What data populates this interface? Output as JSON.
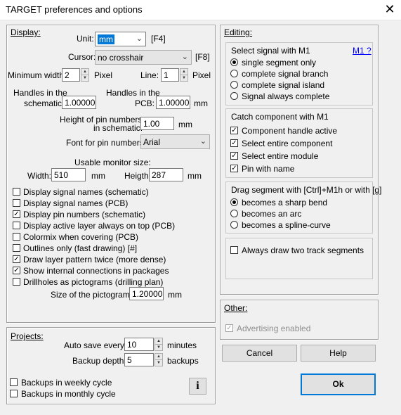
{
  "window": {
    "title": "TARGET preferences and options",
    "close": "✕"
  },
  "display": {
    "heading": "Display:",
    "unit_label": "Unit:",
    "unit_value": "mm",
    "unit_key": "[F4]",
    "cursor_label": "Cursor:",
    "cursor_value": "no crosshair",
    "cursor_key": "[F8]",
    "minwidth_label": "Minimum width:",
    "minwidth_value": "2",
    "minwidth_unit": "Pixel",
    "line_label": "Line:",
    "line_value": "1",
    "line_unit": "Pixel",
    "handles_sch_label1": "Handles in the",
    "handles_sch_label2": "schematic:",
    "handles_sch_value": "1.00000",
    "handles_pcb_label1": "Handles in the",
    "handles_pcb_label2": "PCB:",
    "handles_pcb_value": "1.00000",
    "handles_pcb_unit": "mm",
    "pinheight_label1": "Height of pin numbers",
    "pinheight_label2": "in schematic:",
    "pinheight_value": "1.00",
    "pinheight_unit": "mm",
    "font_label": "Font for pin numbers:",
    "font_value": "Arial",
    "monitor_label": "Usable monitor size:",
    "width_label": "Width:",
    "width_value": "510",
    "width_unit": "mm",
    "height_label": "Heigth:",
    "height_value": "287",
    "height_unit": "mm",
    "checks": [
      {
        "label": "Display signal names (schematic)",
        "checked": false
      },
      {
        "label": "Display signal names (PCB)",
        "checked": false
      },
      {
        "label": "Display pin numbers (schematic)",
        "checked": true
      },
      {
        "label": "Display active layer always on top (PCB)",
        "checked": false
      },
      {
        "label": "Colormix when covering (PCB)",
        "checked": false
      },
      {
        "label": "Outlines only (fast drawing)  [#]",
        "checked": false
      },
      {
        "label": "Draw layer pattern twice (more dense)",
        "checked": true
      },
      {
        "label": "Show internal connections in packages",
        "checked": true
      },
      {
        "label": "Drillholes as pictograms (drilling plan)",
        "checked": false
      }
    ],
    "picto_label": "Size of the pictograms:",
    "picto_value": "1.20000",
    "picto_unit": "mm"
  },
  "projects": {
    "heading": "Projects:",
    "autosave_label": "Auto save every:",
    "autosave_value": "10",
    "autosave_unit": "minutes",
    "depth_label": "Backup depth:",
    "depth_value": "5",
    "depth_unit": "backups",
    "weekly": "Backups in weekly cycle",
    "monthly": "Backups in monthly cycle",
    "info": "i"
  },
  "editing": {
    "heading": "Editing:",
    "m1_title": "Select signal with M1",
    "m1_help": "M1 ?",
    "m1_options": [
      {
        "label": "single segment only",
        "on": true
      },
      {
        "label": "complete signal branch",
        "on": false
      },
      {
        "label": "complete signal island",
        "on": false
      },
      {
        "label": "Signal always complete",
        "on": false
      }
    ],
    "catch_title": "Catch component with M1",
    "catch_options": [
      {
        "label": "Component handle active",
        "checked": true
      },
      {
        "label": "Select entire component",
        "checked": true
      },
      {
        "label": "Select entire module",
        "checked": true
      },
      {
        "label": "Pin with name",
        "checked": true
      }
    ],
    "drag_title": "Drag segment with [Ctrl]+M1h or with [g]",
    "drag_options": [
      {
        "label": "becomes a sharp bend",
        "on": true
      },
      {
        "label": "becomes an arc",
        "on": false
      },
      {
        "label": "becomes a spline-curve",
        "on": false
      }
    ],
    "two_track": "Always draw two track segments"
  },
  "other": {
    "heading": "Other:",
    "advertising": "Advertising enabled"
  },
  "buttons": {
    "cancel": "Cancel",
    "help": "Help",
    "ok": "Ok"
  }
}
